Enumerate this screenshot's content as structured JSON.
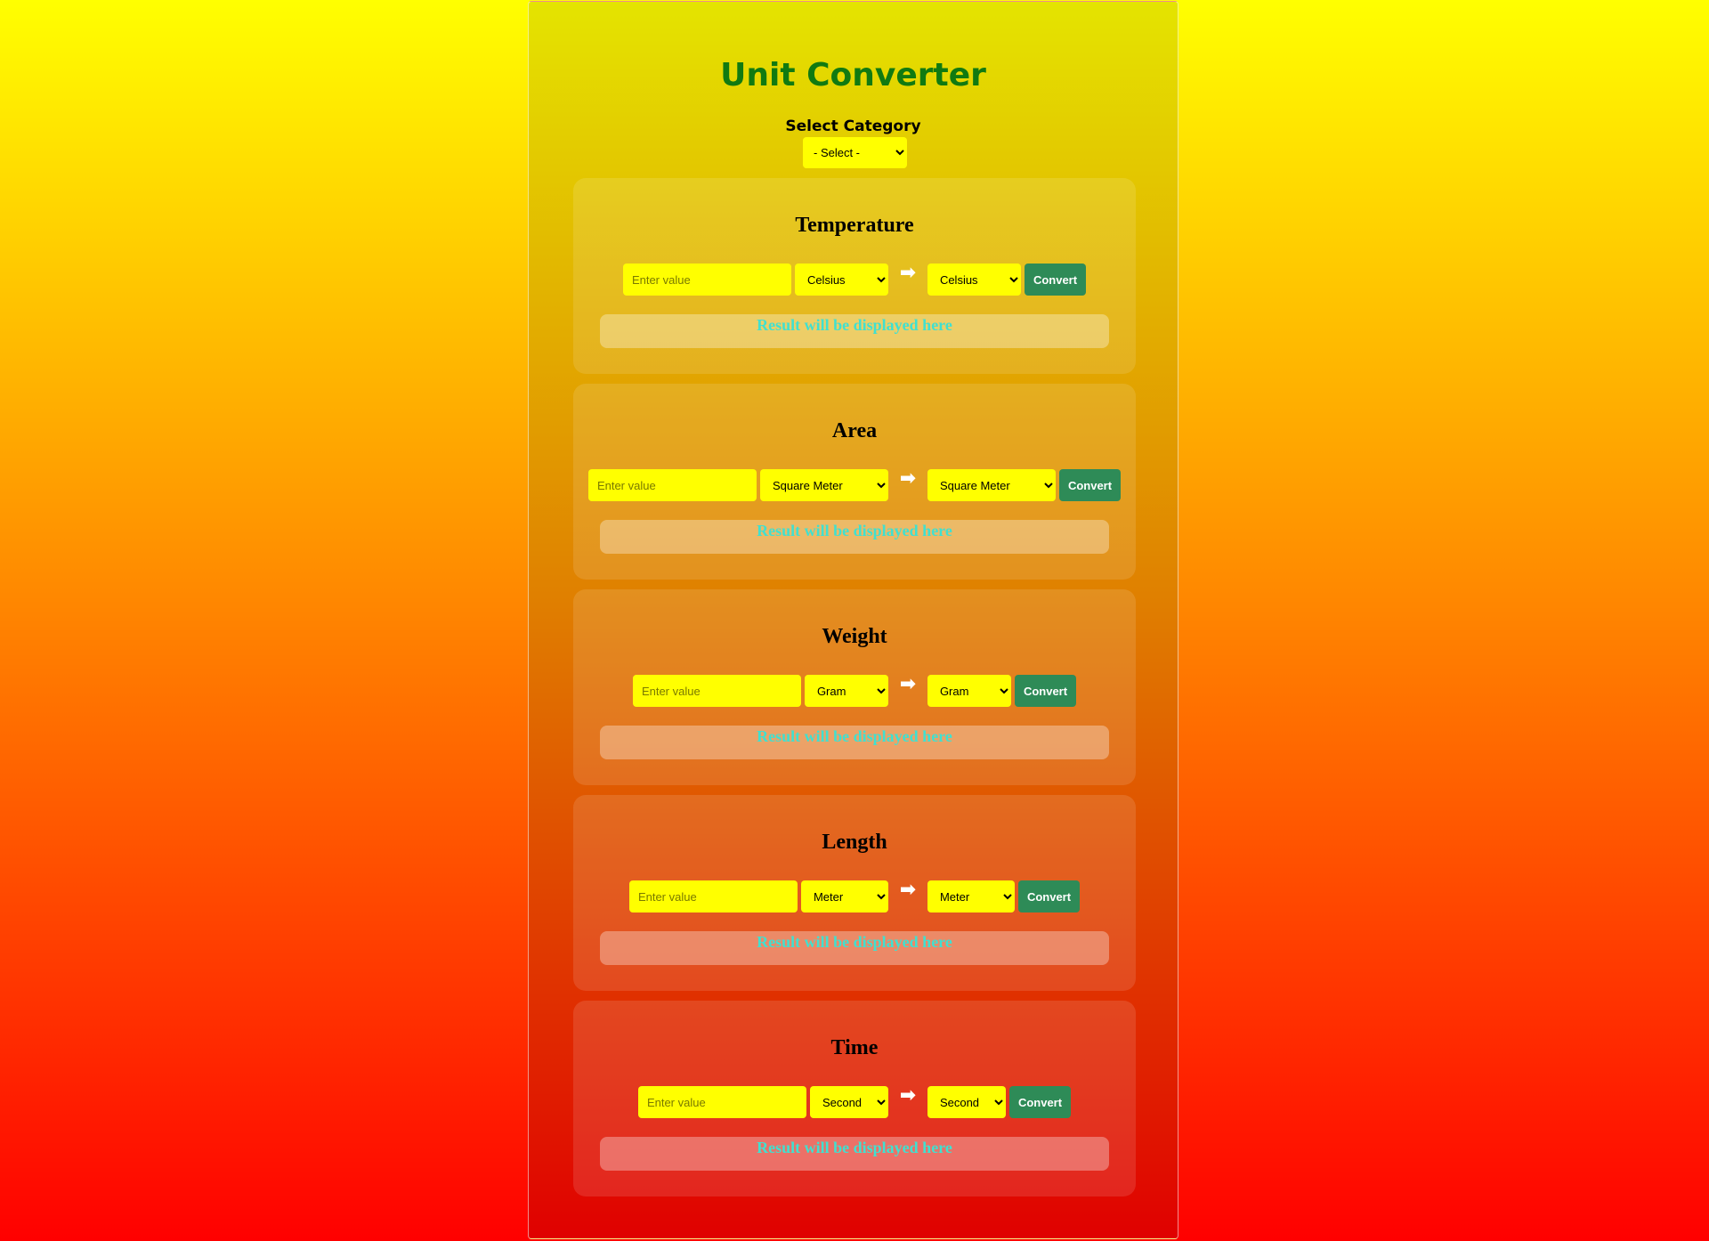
{
  "app": {
    "title": "Unit Converter",
    "category_label": "Select Category",
    "category_selected": "- Select -"
  },
  "arrow_glyph": "➡",
  "converters": [
    {
      "title": "Temperature",
      "placeholder": "Enter value",
      "from_unit": "Celsius",
      "to_unit": "Celsius",
      "convert_label": "Convert",
      "result": "Result will be displayed here"
    },
    {
      "title": "Area",
      "placeholder": "Enter value",
      "from_unit": "Square Meter",
      "to_unit": "Square Meter",
      "convert_label": "Convert",
      "result": "Result will be displayed here"
    },
    {
      "title": "Weight",
      "placeholder": "Enter value",
      "from_unit": "Gram",
      "to_unit": "Gram",
      "convert_label": "Convert",
      "result": "Result will be displayed here"
    },
    {
      "title": "Length",
      "placeholder": "Enter value",
      "from_unit": "Meter",
      "to_unit": "Meter",
      "convert_label": "Convert",
      "result": "Result will be displayed here"
    },
    {
      "title": "Time",
      "placeholder": "Enter value",
      "from_unit": "Second",
      "to_unit": "Second",
      "convert_label": "Convert",
      "result": "Result will be displayed here"
    }
  ],
  "colors": {
    "title": "#117a11",
    "input_bg": "#ffff00",
    "convert_bg": "#2e8b57",
    "result_text": "#40e0d0"
  }
}
